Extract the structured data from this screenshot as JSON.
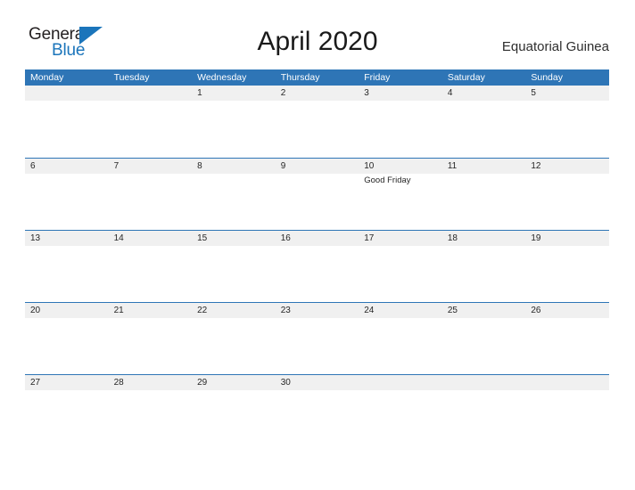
{
  "brand": {
    "name_top": "General",
    "name_bottom": "Blue",
    "color_primary": "#1b75bb",
    "color_text": "#231f20"
  },
  "header": {
    "title": "April 2020",
    "country": "Equatorial Guinea"
  },
  "theme": {
    "header_bar_color": "#2e75b6",
    "day_band_color": "#f0f0f0",
    "row_border_color": "#2e75b6",
    "page_background": "#ffffff",
    "text_color": "#262626"
  },
  "calendar": {
    "month": "April",
    "year": "2020",
    "weekdays": [
      "Monday",
      "Tuesday",
      "Wednesday",
      "Thursday",
      "Friday",
      "Saturday",
      "Sunday"
    ],
    "weeks": [
      {
        "days": [
          {
            "date": "",
            "events": []
          },
          {
            "date": "",
            "events": []
          },
          {
            "date": "1",
            "events": []
          },
          {
            "date": "2",
            "events": []
          },
          {
            "date": "3",
            "events": []
          },
          {
            "date": "4",
            "events": []
          },
          {
            "date": "5",
            "events": []
          }
        ]
      },
      {
        "days": [
          {
            "date": "6",
            "events": []
          },
          {
            "date": "7",
            "events": []
          },
          {
            "date": "8",
            "events": []
          },
          {
            "date": "9",
            "events": []
          },
          {
            "date": "10",
            "events": [
              "Good Friday"
            ]
          },
          {
            "date": "11",
            "events": []
          },
          {
            "date": "12",
            "events": []
          }
        ]
      },
      {
        "days": [
          {
            "date": "13",
            "events": []
          },
          {
            "date": "14",
            "events": []
          },
          {
            "date": "15",
            "events": []
          },
          {
            "date": "16",
            "events": []
          },
          {
            "date": "17",
            "events": []
          },
          {
            "date": "18",
            "events": []
          },
          {
            "date": "19",
            "events": []
          }
        ]
      },
      {
        "days": [
          {
            "date": "20",
            "events": []
          },
          {
            "date": "21",
            "events": []
          },
          {
            "date": "22",
            "events": []
          },
          {
            "date": "23",
            "events": []
          },
          {
            "date": "24",
            "events": []
          },
          {
            "date": "25",
            "events": []
          },
          {
            "date": "26",
            "events": []
          }
        ]
      },
      {
        "days": [
          {
            "date": "27",
            "events": []
          },
          {
            "date": "28",
            "events": []
          },
          {
            "date": "29",
            "events": []
          },
          {
            "date": "30",
            "events": []
          },
          {
            "date": "",
            "events": []
          },
          {
            "date": "",
            "events": []
          },
          {
            "date": "",
            "events": []
          }
        ]
      }
    ]
  }
}
